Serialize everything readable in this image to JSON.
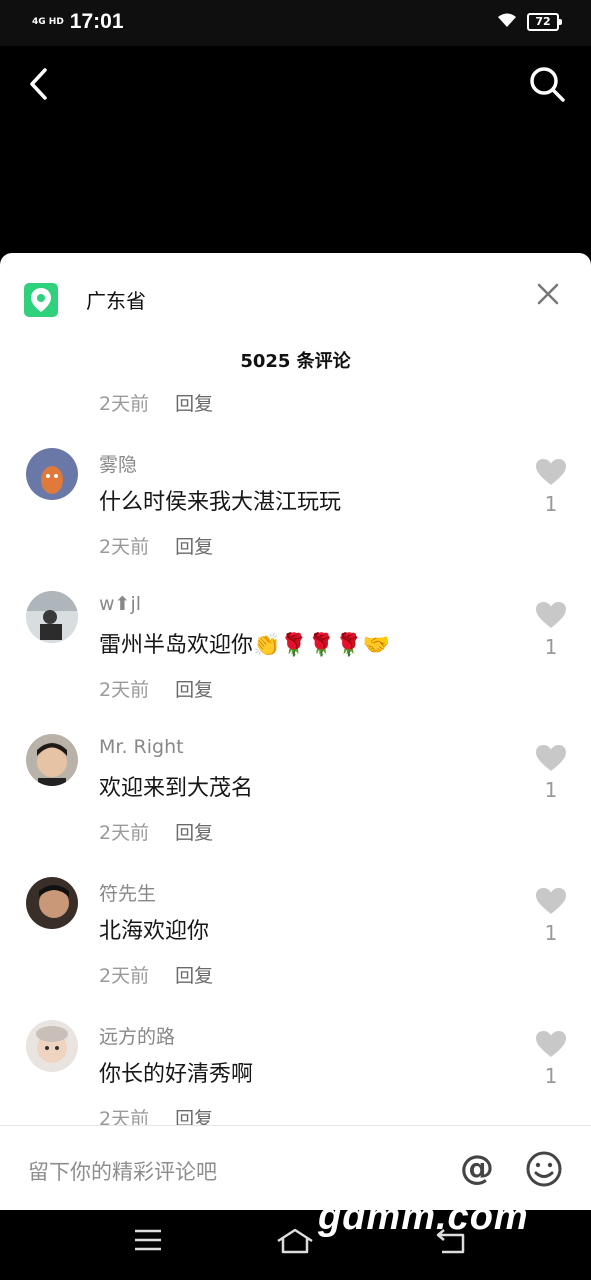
{
  "status": {
    "network": "4G HD",
    "time": "17:01",
    "battery": "72"
  },
  "location": {
    "name": "广东省"
  },
  "comments_header": {
    "count_text": "5025 条评论"
  },
  "partial": {
    "time": "2天前",
    "reply": "回复"
  },
  "comments": [
    {
      "user": "雾隐",
      "text": "什么时侯来我大湛江玩玩",
      "time": "2天前",
      "reply": "回复",
      "likes": "1"
    },
    {
      "user": "w⬆jl",
      "text": "雷州半岛欢迎你👏🌹🌹🌹🤝",
      "time": "2天前",
      "reply": "回复",
      "likes": "1"
    },
    {
      "user": "Mr. Right",
      "text": "欢迎来到大茂名",
      "time": "2天前",
      "reply": "回复",
      "likes": "1"
    },
    {
      "user": "符先生",
      "text": "北海欢迎你",
      "time": "2天前",
      "reply": "回复",
      "likes": "1"
    },
    {
      "user": "远方的路",
      "text": "你长的好清秀啊",
      "time": "2天前",
      "reply": "回复",
      "likes": "1"
    }
  ],
  "input": {
    "placeholder": "留下你的精彩评论吧",
    "at_label": "@"
  },
  "watermark": "gdmm.com",
  "colors": {
    "accent_green": "#2fd17c",
    "like_gray": "#c8c8c8"
  }
}
